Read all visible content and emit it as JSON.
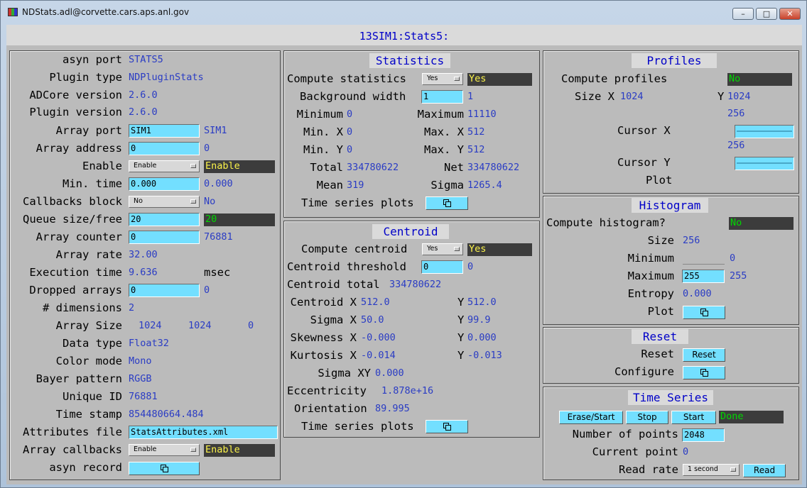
{
  "window": {
    "title": "NDStats.adl@corvette.cars.aps.anl.gov",
    "minimize": "–",
    "maximize": "□",
    "close": "✕"
  },
  "header": {
    "title": "13SIM1:Stats5:"
  },
  "left": {
    "asyn_port_label": "asyn port",
    "asyn_port": "STATS5",
    "plugin_type_label": "Plugin type",
    "plugin_type": "NDPluginStats",
    "adcore_version_label": "ADCore version",
    "adcore_version": "2.6.0",
    "plugin_version_label": "Plugin version",
    "plugin_version": "2.6.0",
    "array_port_label": "Array port",
    "array_port_input": "SIM1",
    "array_port": "SIM1",
    "array_address_label": "Array address",
    "array_address_input": "0",
    "array_address": "0",
    "enable_label": "Enable",
    "enable_menu": "Enable",
    "enable_status": "Enable",
    "min_time_label": "Min. time",
    "min_time_input": "0.000",
    "min_time": "0.000",
    "callbacks_block_label": "Callbacks block",
    "callbacks_block_menu": "No",
    "callbacks_block": "No",
    "queue_label": "Queue size/free",
    "queue_input": "20",
    "queue_status": "20",
    "array_counter_label": "Array counter",
    "array_counter_input": "0",
    "array_counter": "76881",
    "array_rate_label": "Array rate",
    "array_rate": "32.00",
    "execution_time_label": "Execution time",
    "execution_time": "9.636",
    "execution_unit": "msec",
    "dropped_label": "Dropped arrays",
    "dropped_input": "0",
    "dropped": "0",
    "dimensions_label": "# dimensions",
    "dimensions": "2",
    "array_size_label": "Array Size",
    "array_size": [
      "1024",
      "1024",
      "0"
    ],
    "data_type_label": "Data type",
    "data_type": "Float32",
    "color_mode_label": "Color mode",
    "color_mode": "Mono",
    "bayer_label": "Bayer pattern",
    "bayer": "RGGB",
    "unique_id_label": "Unique ID",
    "unique_id": "76881",
    "time_stamp_label": "Time stamp",
    "time_stamp": "854480664.484",
    "attributes_label": "Attributes file",
    "attributes_input": "StatsAttributes.xml",
    "array_callbacks_label": "Array callbacks",
    "array_callbacks_menu": "Enable",
    "array_callbacks": "Enable",
    "asyn_record_label": "asyn record"
  },
  "statistics": {
    "title": "Statistics",
    "compute_label": "Compute statistics",
    "compute_menu": "Yes",
    "compute_status": "Yes",
    "bg_width_label": "Background width",
    "bg_width_input": "1",
    "bg_width": "1",
    "minimum_label": "Minimum",
    "minimum": "0",
    "maximum_label": "Maximum",
    "maximum": "11110",
    "minx_label": "Min. X",
    "minx": "0",
    "maxx_label": "Max. X",
    "maxx": "512",
    "miny_label": "Min. Y",
    "miny": "0",
    "maxy_label": "Max. Y",
    "maxy": "512",
    "total_label": "Total",
    "total": "334780622",
    "net_label": "Net",
    "net": "334780622",
    "mean_label": "Mean",
    "mean": "319",
    "sigma_label": "Sigma",
    "sigma": "1265.4",
    "ts_plots_label": "Time series plots"
  },
  "centroid": {
    "title": "Centroid",
    "compute_label": "Compute centroid",
    "compute_menu": "Yes",
    "compute_status": "Yes",
    "threshold_label": "Centroid threshold",
    "threshold_input": "0",
    "threshold": "0",
    "total_label": "Centroid total",
    "total": "334780622",
    "centroid_label": "Centroid X",
    "cx": "512.0",
    "cy_label": "Y",
    "cy": "512.0",
    "sigma_label": "Sigma X",
    "sx": "50.0",
    "sy_label": "Y",
    "sy": "99.9",
    "skew_label": "Skewness X",
    "skx": "-0.000",
    "sky_label": "Y",
    "sky": "0.000",
    "kurt_label": "Kurtosis X",
    "kx": "-0.014",
    "ky_label": "Y",
    "ky": "-0.013",
    "sigmaxy_label": "Sigma XY",
    "sigmaxy": "0.000",
    "ecc_label": "Eccentricity",
    "ecc": "1.878e+16",
    "orient_label": "Orientation",
    "orient": "89.995",
    "ts_plots_label": "Time series plots"
  },
  "profiles": {
    "title": "Profiles",
    "compute_label": "Compute profiles",
    "compute_status": "No",
    "size_label": "Size X",
    "size_x": "1024",
    "size_y_label": "Y",
    "size_y": "1024",
    "cursor_x_value": "256",
    "cursor_x_label": "Cursor X",
    "cursor_y_value": "256",
    "cursor_y_label": "Cursor Y",
    "plot_label": "Plot"
  },
  "histogram": {
    "title": "Histogram",
    "compute_label": "Compute histogram?",
    "compute_status": "No",
    "size_label": "Size",
    "size": "256",
    "minimum_label": "Minimum",
    "minimum": "0",
    "maximum_label": "Maximum",
    "maximum_input": "255",
    "maximum": "255",
    "entropy_label": "Entropy",
    "entropy": "0.000",
    "plot_label": "Plot"
  },
  "reset": {
    "title": "Reset",
    "reset_label": "Reset",
    "reset_button": "Reset",
    "configure_label": "Configure"
  },
  "timeseries": {
    "title": "Time Series",
    "erase_start": "Erase/Start",
    "stop": "Stop",
    "start": "Start",
    "status": "Done",
    "num_points_label": "Number of points",
    "num_points_input": "2048",
    "current_point_label": "Current point",
    "current_point": "0",
    "read_rate_label": "Read rate",
    "read_rate_menu": "1 second",
    "read_button": "Read"
  },
  "colors": {
    "label_blue": "#0000c8",
    "value_blue": "#2a3cc4",
    "input_cyan": "#73dfff",
    "status_bg": "#3c3c3c"
  },
  "icons": {
    "related_display": "related-display-icon",
    "menu_arrow": "menu-arrow-icon"
  }
}
